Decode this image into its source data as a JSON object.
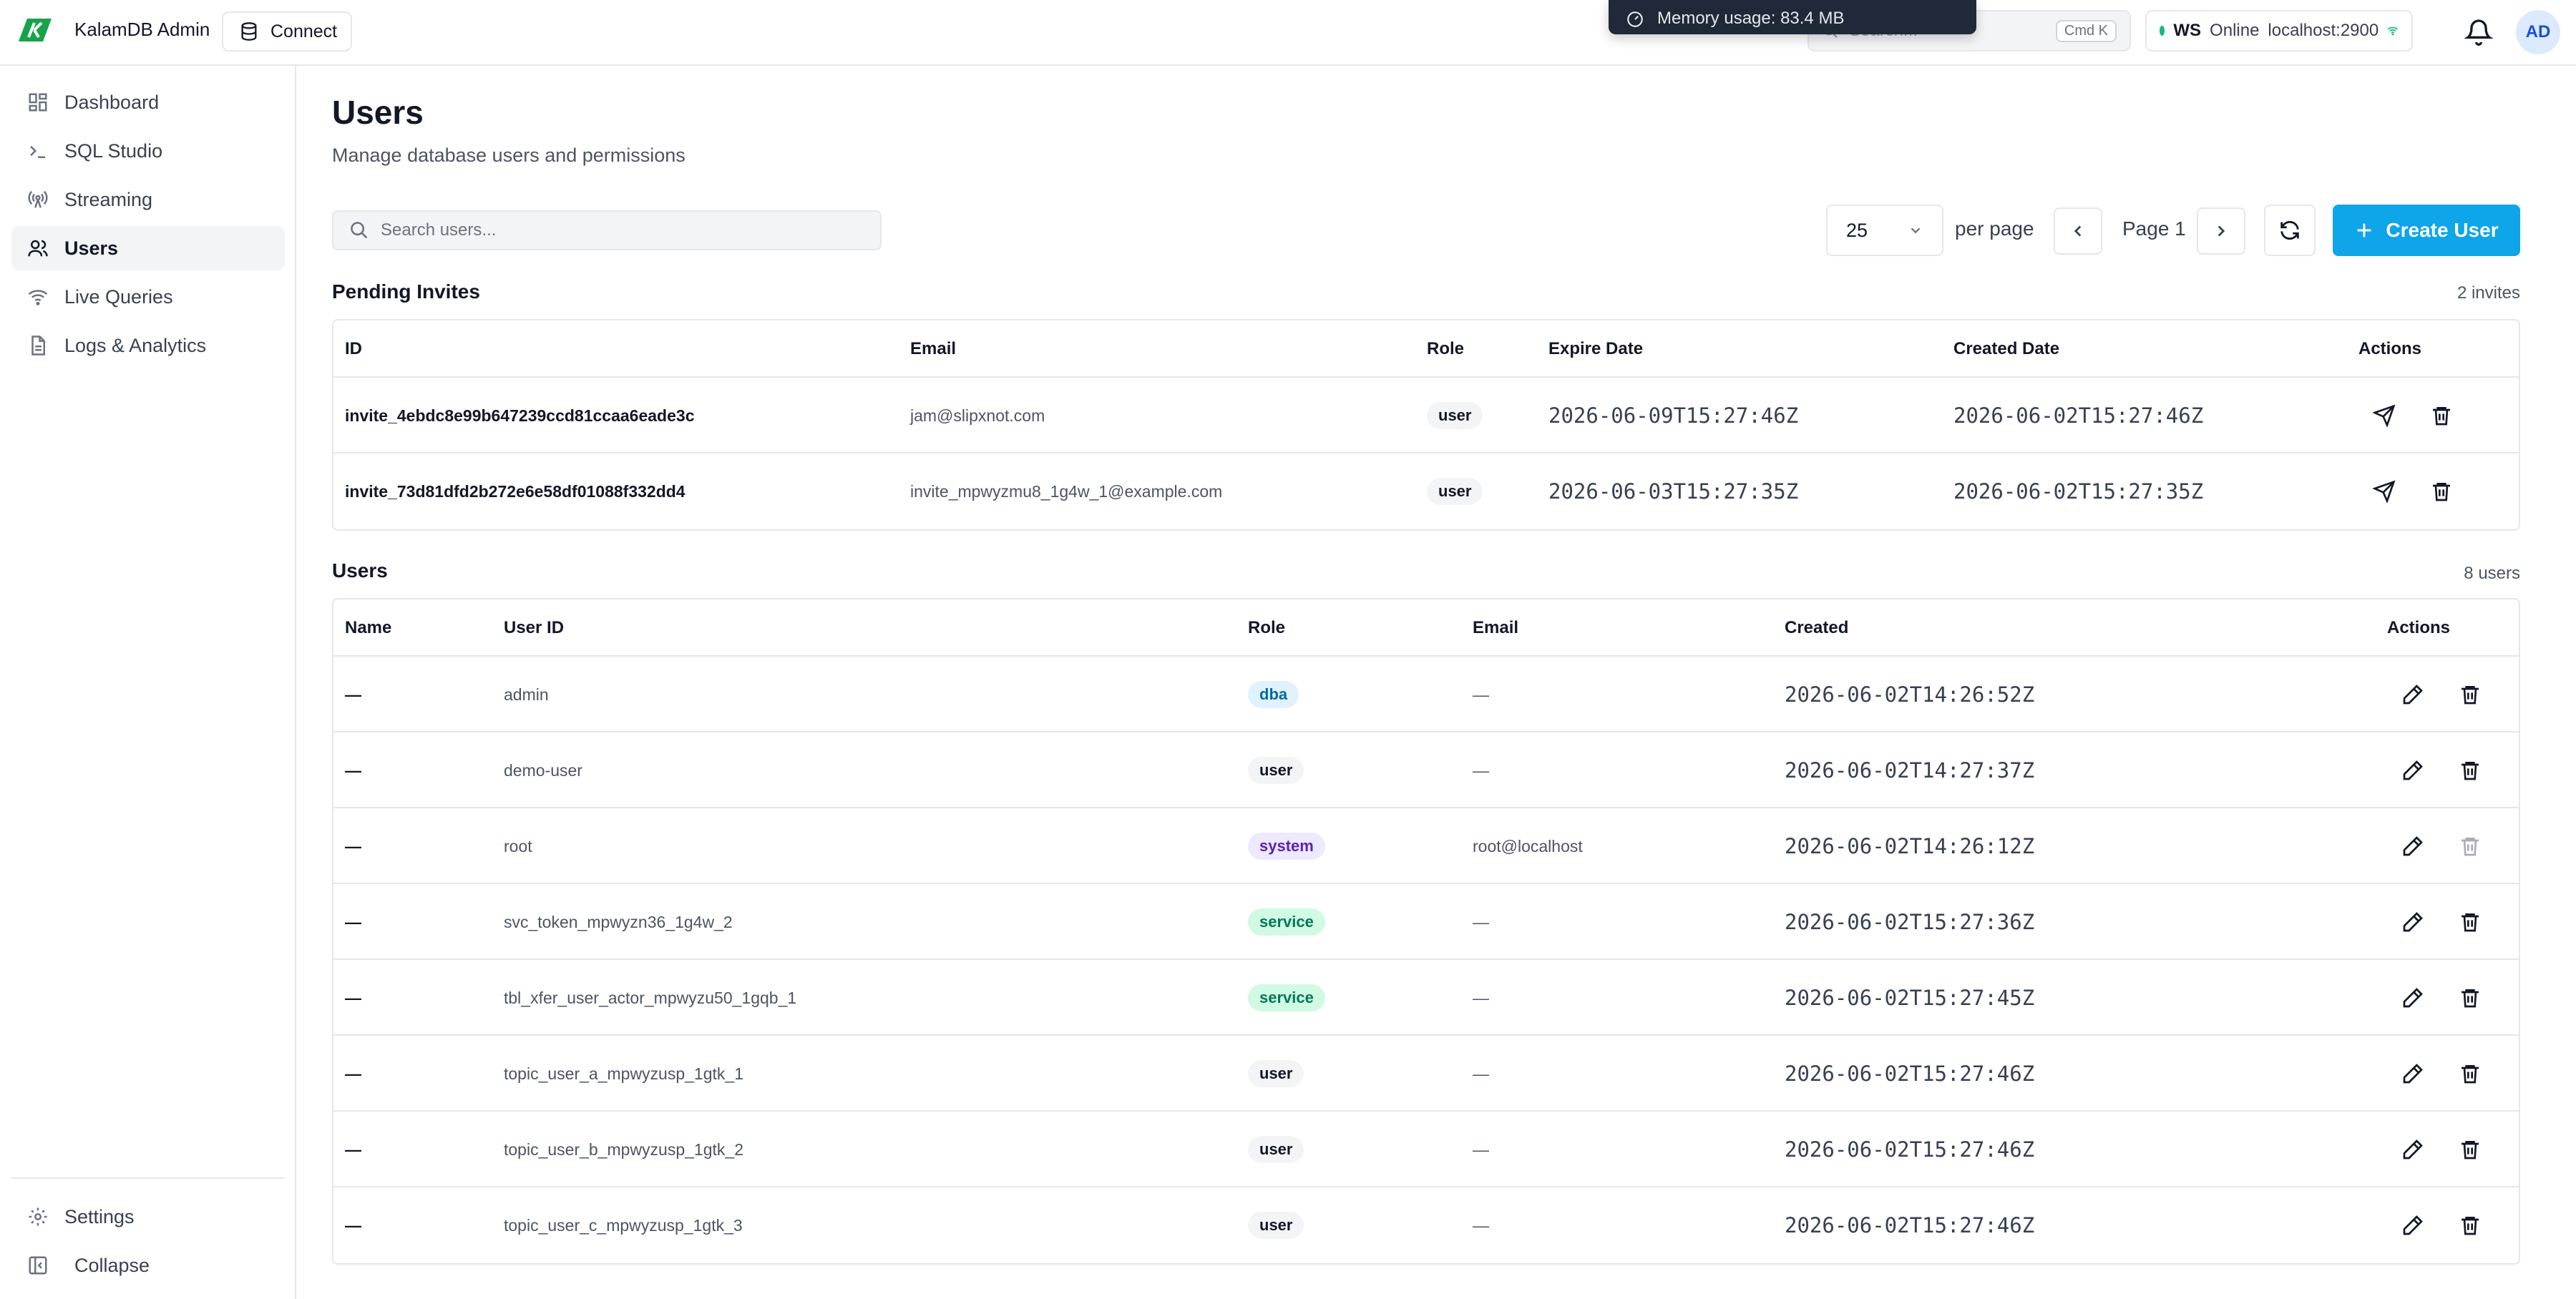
{
  "app": {
    "title": "KalamDB Admin",
    "connect_label": "Connect"
  },
  "topbar": {
    "search_placeholder": "Search...",
    "shortcut": "Cmd K",
    "ws_label": "WS",
    "ws_status": "Online",
    "ws_host": "localhost:2900",
    "avatar_initials": "AD",
    "toast": "Memory usage: 83.4 MB"
  },
  "sidebar": {
    "items": [
      {
        "label": "Dashboard",
        "icon": "dashboard-icon"
      },
      {
        "label": "SQL Studio",
        "icon": "terminal-icon"
      },
      {
        "label": "Streaming",
        "icon": "broadcast-icon"
      },
      {
        "label": "Users",
        "icon": "users-icon",
        "active": true
      },
      {
        "label": "Live Queries",
        "icon": "wifi-icon"
      },
      {
        "label": "Logs & Analytics",
        "icon": "file-text-icon"
      }
    ],
    "settings_label": "Settings",
    "collapse_label": "Collapse"
  },
  "page": {
    "title": "Users",
    "subtitle": "Manage database users and permissions",
    "search_placeholder": "Search users...",
    "per_page_value": "25",
    "per_page_label": "per page",
    "page_label": "Page 1",
    "create_label": "Create User"
  },
  "invites": {
    "title": "Pending Invites",
    "count": "2 invites",
    "headers": {
      "id": "ID",
      "email": "Email",
      "role": "Role",
      "expire": "Expire Date",
      "created": "Created Date",
      "actions": "Actions"
    },
    "rows": [
      {
        "id": "invite_4ebdc8e99b647239ccd81ccaa6eade3c",
        "email": "jam@slipxnot.com",
        "role": "user",
        "expire": "2026-06-09T15:27:46Z",
        "created": "2026-06-02T15:27:46Z"
      },
      {
        "id": "invite_73d81dfd2b272e6e58df01088f332dd4",
        "email": "invite_mpwyzmu8_1g4w_1@example.com",
        "role": "user",
        "expire": "2026-06-03T15:27:35Z",
        "created": "2026-06-02T15:27:35Z"
      }
    ]
  },
  "users": {
    "title": "Users",
    "count": "8 users",
    "headers": {
      "name": "Name",
      "user_id": "User ID",
      "role": "Role",
      "email": "Email",
      "created": "Created",
      "actions": "Actions"
    },
    "rows": [
      {
        "name": "—",
        "user_id": "admin",
        "role": "dba",
        "email": "—",
        "created": "2026-06-02T14:26:52Z",
        "delete_disabled": false
      },
      {
        "name": "—",
        "user_id": "demo-user",
        "role": "user",
        "email": "—",
        "created": "2026-06-02T14:27:37Z",
        "delete_disabled": false
      },
      {
        "name": "—",
        "user_id": "root",
        "role": "system",
        "email": "root@localhost",
        "created": "2026-06-02T14:26:12Z",
        "delete_disabled": true
      },
      {
        "name": "—",
        "user_id": "svc_token_mpwyzn36_1g4w_2",
        "role": "service",
        "email": "—",
        "created": "2026-06-02T15:27:36Z",
        "delete_disabled": false
      },
      {
        "name": "—",
        "user_id": "tbl_xfer_user_actor_mpwyzu50_1gqb_1",
        "role": "service",
        "email": "—",
        "created": "2026-06-02T15:27:45Z",
        "delete_disabled": false
      },
      {
        "name": "—",
        "user_id": "topic_user_a_mpwyzusp_1gtk_1",
        "role": "user",
        "email": "—",
        "created": "2026-06-02T15:27:46Z",
        "delete_disabled": false
      },
      {
        "name": "—",
        "user_id": "topic_user_b_mpwyzusp_1gtk_2",
        "role": "user",
        "email": "—",
        "created": "2026-06-02T15:27:46Z",
        "delete_disabled": false
      },
      {
        "name": "—",
        "user_id": "topic_user_c_mpwyzusp_1gtk_3",
        "role": "user",
        "email": "—",
        "created": "2026-06-02T15:27:46Z",
        "delete_disabled": false
      }
    ]
  },
  "colors": {
    "accent": "#0ea5e9",
    "online": "#10b981",
    "brand": "#16a34a"
  }
}
